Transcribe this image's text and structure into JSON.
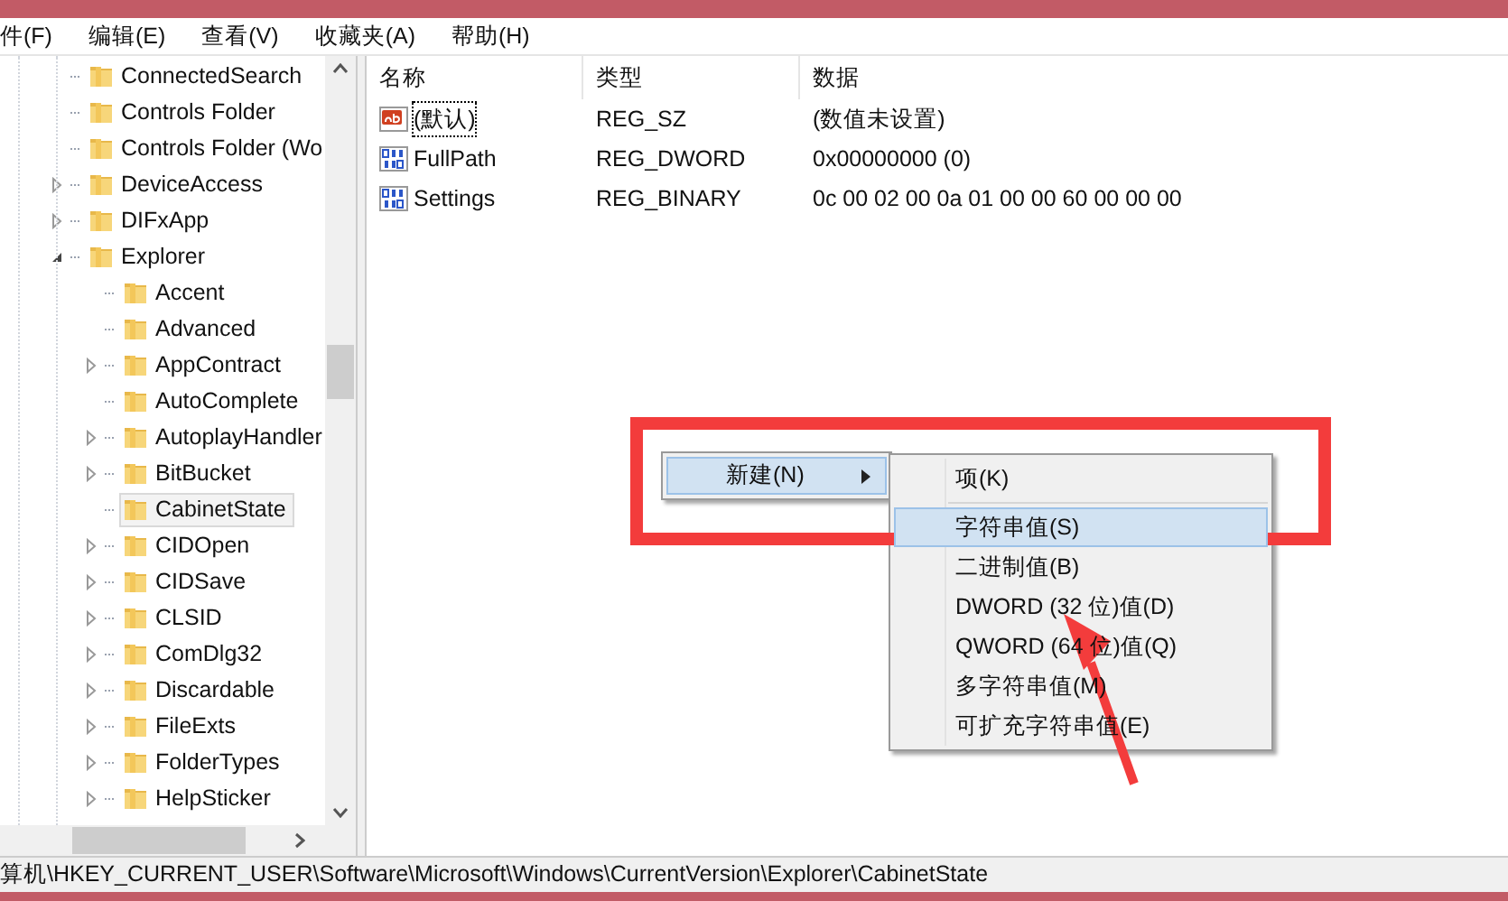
{
  "menu_bar": [
    "件(F)",
    "编辑(E)",
    "查看(V)",
    "收藏夹(A)",
    "帮助(H)"
  ],
  "tree": [
    {
      "label": "ConnectedSearch",
      "expandable": false,
      "selected": false
    },
    {
      "label": "Controls Folder",
      "expandable": false,
      "selected": false
    },
    {
      "label": "Controls Folder (Wo",
      "expandable": false,
      "selected": false
    },
    {
      "label": "DeviceAccess",
      "expandable": true,
      "selected": false
    },
    {
      "label": "DIFxApp",
      "expandable": true,
      "selected": false
    },
    {
      "label": "Explorer",
      "expandable": true,
      "expanded": true,
      "selected": false,
      "children": [
        {
          "label": "Accent",
          "expandable": false,
          "selected": false
        },
        {
          "label": "Advanced",
          "expandable": false,
          "selected": false
        },
        {
          "label": "AppContract",
          "expandable": true,
          "selected": false
        },
        {
          "label": "AutoComplete",
          "expandable": false,
          "selected": false
        },
        {
          "label": "AutoplayHandler",
          "expandable": true,
          "selected": false
        },
        {
          "label": "BitBucket",
          "expandable": true,
          "selected": false
        },
        {
          "label": "CabinetState",
          "expandable": false,
          "selected": true
        },
        {
          "label": "CIDOpen",
          "expandable": true,
          "selected": false
        },
        {
          "label": "CIDSave",
          "expandable": true,
          "selected": false
        },
        {
          "label": "CLSID",
          "expandable": true,
          "selected": false
        },
        {
          "label": "ComDlg32",
          "expandable": true,
          "selected": false
        },
        {
          "label": "Discardable",
          "expandable": true,
          "selected": false
        },
        {
          "label": "FileExts",
          "expandable": true,
          "selected": false
        },
        {
          "label": "FolderTypes",
          "expandable": true,
          "selected": false
        },
        {
          "label": "HelpSticker",
          "expandable": true,
          "selected": false
        }
      ]
    }
  ],
  "table": {
    "columns": [
      "名称",
      "类型",
      "数据"
    ],
    "rows": [
      {
        "kind": "string",
        "name": "(默认)",
        "type": "REG_SZ",
        "data": "(数值未设置)",
        "focused": true
      },
      {
        "kind": "binary",
        "name": "FullPath",
        "type": "REG_DWORD",
        "data": "0x00000000 (0)",
        "focused": false
      },
      {
        "kind": "binary",
        "name": "Settings",
        "type": "REG_BINARY",
        "data": "0c 00 02 00 0a 01 00 00 60 00 00 00",
        "focused": false
      }
    ]
  },
  "context_menu": {
    "item": {
      "label": "新建(N)",
      "selected": true
    },
    "submenu": [
      {
        "label": "项(K)",
        "selected": false,
        "separator_after": true
      },
      {
        "label": "字符串值(S)",
        "selected": true,
        "separator_after": false
      },
      {
        "label": "二进制值(B)",
        "selected": false,
        "separator_after": false
      },
      {
        "label": "DWORD (32 位)值(D)",
        "selected": false,
        "separator_after": false
      },
      {
        "label": "QWORD (64 位)值(Q)",
        "selected": false,
        "separator_after": false
      },
      {
        "label": "多字符串值(M)",
        "selected": false,
        "separator_after": false
      },
      {
        "label": "可扩充字符串值(E)",
        "selected": false,
        "separator_after": false
      }
    ]
  },
  "status_bar": "算机\\HKEY_CURRENT_USER\\Software\\Microsoft\\Windows\\CurrentVersion\\Explorer\\CabinetState"
}
